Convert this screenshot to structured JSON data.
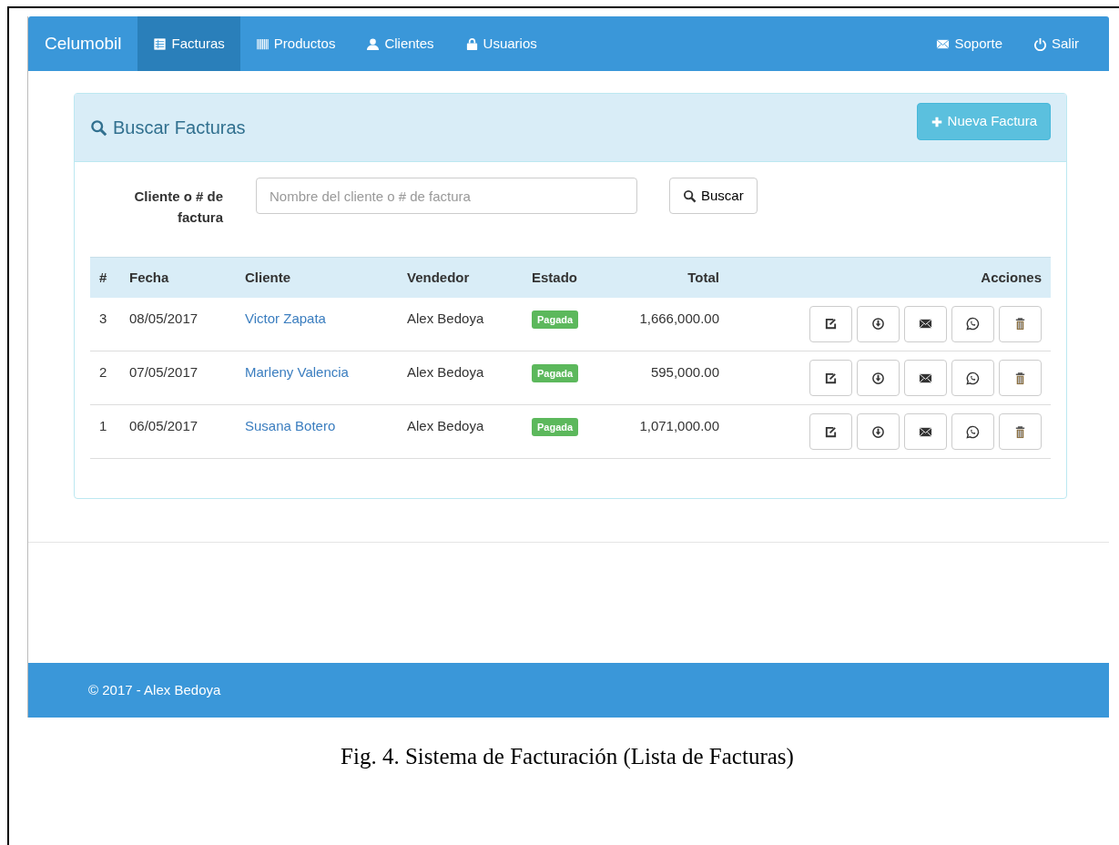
{
  "navbar": {
    "brand": "Celumobil",
    "items": [
      {
        "label": "Facturas",
        "selected": true
      },
      {
        "label": "Productos",
        "selected": false
      },
      {
        "label": "Clientes",
        "selected": false
      },
      {
        "label": "Usuarios",
        "selected": false
      }
    ],
    "right_items": [
      {
        "label": "Soporte",
        "selected": false
      },
      {
        "label": "Salir",
        "selected": false
      }
    ]
  },
  "panel": {
    "title": "Buscar Facturas",
    "new_button": "Nueva Factura",
    "search": {
      "label": "Cliente o # de factura",
      "placeholder": "Nombre del cliente o # de factura",
      "button": "Buscar"
    },
    "table": {
      "columns": [
        "#",
        "Fecha",
        "Cliente",
        "Vendedor",
        "Estado",
        "Total",
        "Acciones"
      ],
      "rows": [
        {
          "number": "3",
          "date": "08/05/2017",
          "client": "Victor Zapata",
          "seller": "Alex Bedoya",
          "status": "Pagada",
          "color": "#5cb85c",
          "total": "1,666,000.00"
        },
        {
          "number": "2",
          "date": "07/05/2017",
          "client": "Marleny Valencia",
          "seller": "Alex Bedoya",
          "status": "Pagada",
          "color": "#5cb85c",
          "total": "595,000.00"
        },
        {
          "number": "1",
          "date": "06/05/2017",
          "client": "Susana Botero",
          "seller": "Alex Bedoya",
          "status": "Pagada",
          "color": "#5cb85c",
          "total": "1,071,000.00"
        }
      ]
    }
  },
  "footer": "© 2017 - Alex Bedoya",
  "caption": "Fig. 4. Sistema de Facturación (Lista de Facturas)"
}
